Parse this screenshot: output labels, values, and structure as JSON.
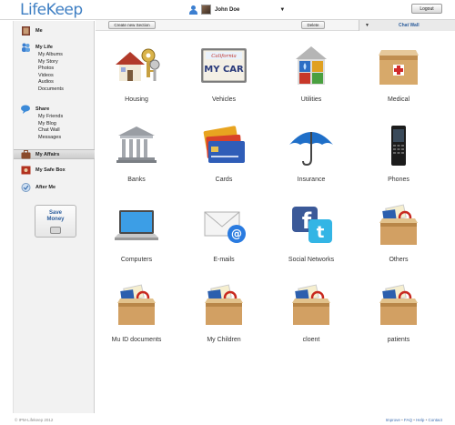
{
  "app": {
    "logo": "LifeKeep"
  },
  "header": {
    "user_name": "John Doe",
    "logout_label": "Logout"
  },
  "sidebar": {
    "me": "Me",
    "my_life": "My Life",
    "my_life_items": [
      "My Albums",
      "My Story",
      "Photos",
      "Videos",
      "Audios",
      "Documents"
    ],
    "share": "Share",
    "share_items": [
      "My Friends",
      "My Blog",
      "Chat Wall",
      "Messages"
    ],
    "my_affairs": "My Affairs",
    "safe_box": "My Safe Box",
    "after_me": "After Me",
    "save_money_line1": "Save",
    "save_money_line2": "Money"
  },
  "toolbar": {
    "create_label": "Create new Section",
    "delete_label": "Delete",
    "chat_wall_label": "Chat Wall"
  },
  "tiles": [
    {
      "label": "Housing",
      "icon": "house-keys-icon"
    },
    {
      "label": "Vehicles",
      "icon": "license-plate-icon"
    },
    {
      "label": "Utilities",
      "icon": "utilities-house-icon"
    },
    {
      "label": "Medical",
      "icon": "medical-box-icon"
    },
    {
      "label": "Banks",
      "icon": "bank-icon"
    },
    {
      "label": "Cards",
      "icon": "credit-cards-icon"
    },
    {
      "label": "Insurance",
      "icon": "umbrella-icon"
    },
    {
      "label": "Phones",
      "icon": "mobile-phone-icon"
    },
    {
      "label": "Computers",
      "icon": "laptop-icon"
    },
    {
      "label": "E-mails",
      "icon": "envelope-icon"
    },
    {
      "label": "Social Networks",
      "icon": "social-networks-icon"
    },
    {
      "label": "Others",
      "icon": "box-icon"
    },
    {
      "label": "Mu ID documents",
      "icon": "box-icon"
    },
    {
      "label": "My Children",
      "icon": "box-icon"
    },
    {
      "label": "cloent",
      "icon": "box-icon"
    },
    {
      "label": "patients",
      "icon": "box-icon"
    }
  ],
  "plate_text": {
    "state": "California",
    "number": "MY CAR"
  },
  "footer": {
    "copyright": "© IPM-Lifekeep 2012",
    "links": [
      "Improve",
      "FAQ",
      "Help",
      "Contact"
    ]
  }
}
